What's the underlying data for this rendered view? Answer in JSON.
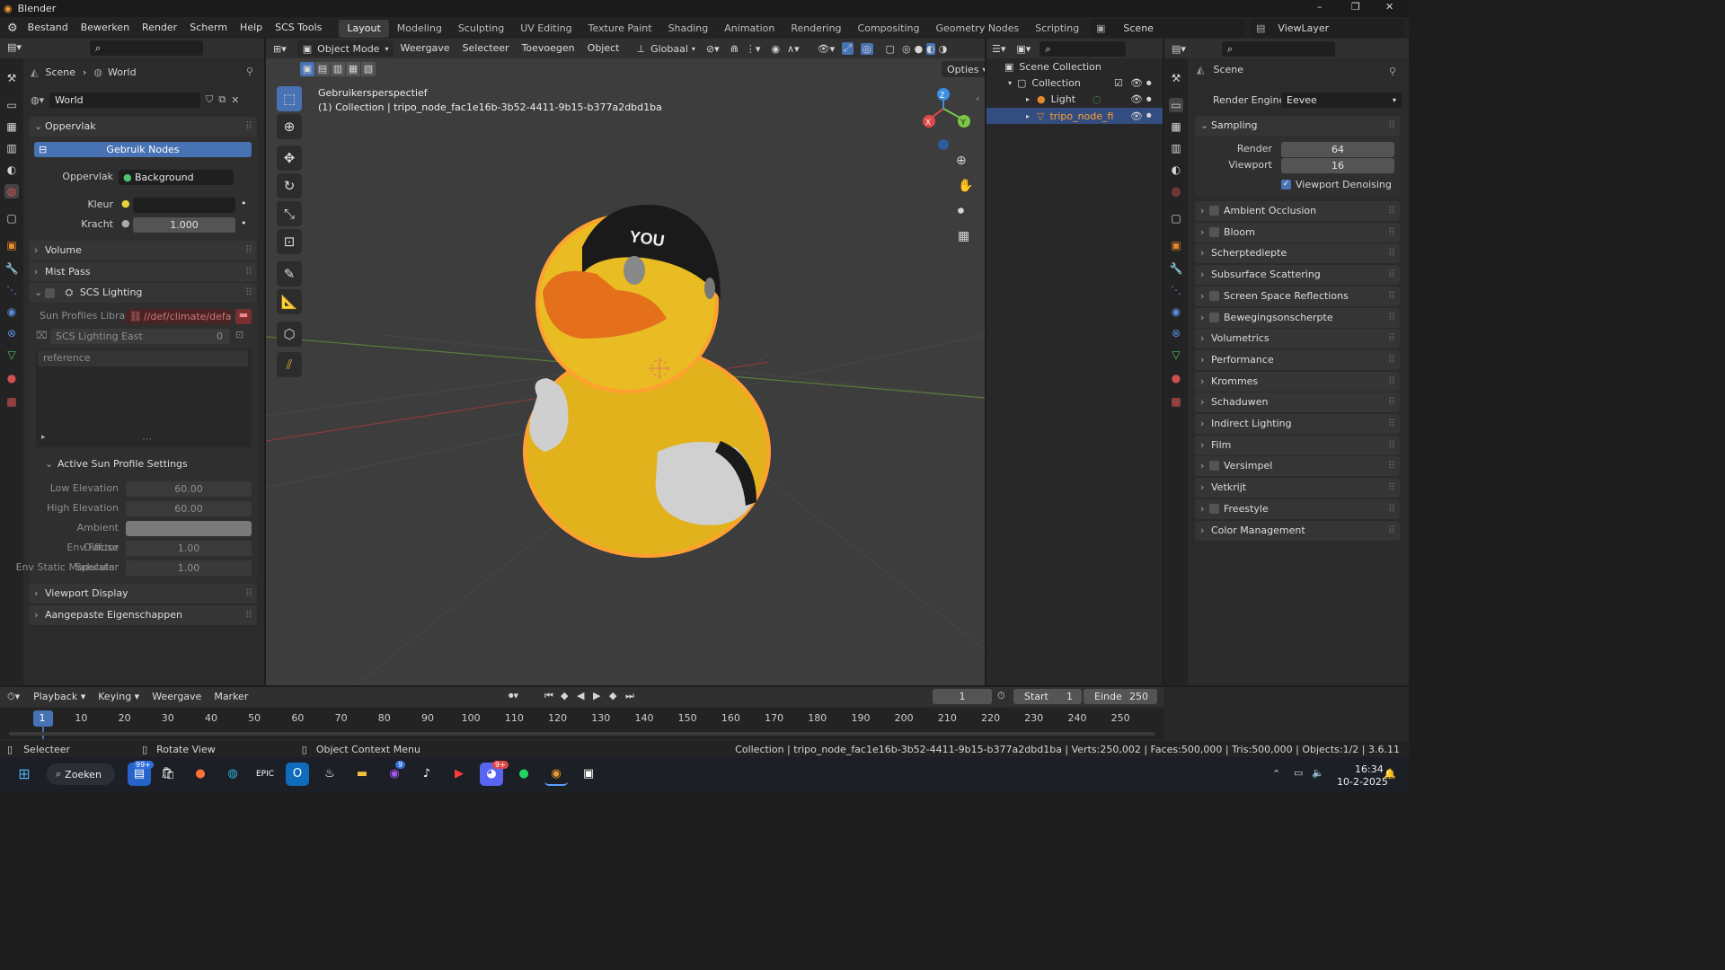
{
  "app": {
    "title": "Blender",
    "window_controls": [
      "–",
      "❐",
      "✕"
    ]
  },
  "menus": [
    "Bestand",
    "Bewerken",
    "Render",
    "Scherm",
    "Help",
    "SCS Tools"
  ],
  "workspace_tabs": [
    "Layout",
    "Modeling",
    "Sculpting",
    "UV Editing",
    "Texture Paint",
    "Shading",
    "Animation",
    "Rendering",
    "Compositing",
    "Geometry Nodes",
    "Scripting"
  ],
  "active_tab": "Layout",
  "scene_name": "Scene",
  "view_layer": "ViewLayer",
  "left_panel": {
    "breadcrumb": {
      "scene": "Scene",
      "world": "World"
    },
    "world_name": "World",
    "surface_header": "Oppervlak",
    "use_nodes_label": "Gebruik Nodes",
    "surface_label": "Oppervlak",
    "surface_value": "Background",
    "color_label": "Kleur",
    "strength_label": "Kracht",
    "strength_value": "1.000",
    "sections": {
      "volume": "Volume",
      "mist": "Mist Pass",
      "scs": "SCS Lighting",
      "viewport_display": "Viewport Display",
      "custom_props": "Aangepaste Eigenschappen"
    },
    "sun_profiles_label": "Sun Profiles Library",
    "sun_profiles_value": "//def/climate/defa...",
    "scs_east_label": "SCS Lighting East",
    "scs_east_value": "0",
    "list_item": "reference",
    "active_profile_header": "Active Sun Profile Settings",
    "profile_fields": [
      {
        "label": "Low Elevation",
        "value": "60.00"
      },
      {
        "label": "High Elevation",
        "value": "60.00"
      },
      {
        "label": "Ambient",
        "value": ""
      },
      {
        "label": "Diffuse",
        "value": ""
      },
      {
        "label": "Specular",
        "value": ""
      },
      {
        "label": "Env Factor",
        "value": "1.00"
      },
      {
        "label": "Env Static Modulator",
        "value": "1.00"
      }
    ]
  },
  "viewport": {
    "mode": "Object Mode",
    "menus": [
      "Weergave",
      "Selecteer",
      "Toevoegen",
      "Object"
    ],
    "orientation": "Globaal",
    "options_label": "Opties",
    "view_name": "Gebruikersperspectief",
    "collection_info": "(1) Collection | tripo_node_fac1e16b-3b52-4411-9b15-b377a2dbd1ba",
    "cap_text": "YOU",
    "gizmo_axes": {
      "x": "X",
      "y": "Y",
      "z": "Z"
    }
  },
  "outliner": {
    "root": "Scene Collection",
    "collection": "Collection",
    "items": [
      {
        "name": "Light"
      },
      {
        "name": "tripo_node_fi"
      }
    ]
  },
  "properties": {
    "header": "Scene",
    "render_engine_label": "Render Engine",
    "render_engine": "Eevee",
    "sampling_header": "Sampling",
    "render_label": "Render",
    "render_samples": "64",
    "viewport_label": "Viewport",
    "viewport_samples": "16",
    "denoise_label": "Viewport Denoising",
    "sections": [
      {
        "label": "Ambient Occlusion",
        "checkbox": true
      },
      {
        "label": "Bloom",
        "checkbox": true
      },
      {
        "label": "Scherptediepte",
        "checkbox": false
      },
      {
        "label": "Subsurface Scattering",
        "checkbox": false
      },
      {
        "label": "Screen Space Reflections",
        "checkbox": true
      },
      {
        "label": "Bewegingsonscherpte",
        "checkbox": true
      },
      {
        "label": "Volumetrics",
        "checkbox": false
      },
      {
        "label": "Performance",
        "checkbox": false
      },
      {
        "label": "Krommes",
        "checkbox": false
      },
      {
        "label": "Schaduwen",
        "checkbox": false
      },
      {
        "label": "Indirect Lighting",
        "checkbox": false
      },
      {
        "label": "Film",
        "checkbox": false
      },
      {
        "label": "Versimpel",
        "checkbox": true
      },
      {
        "label": "Vetkrijt",
        "checkbox": false
      },
      {
        "label": "Freestyle",
        "checkbox": true
      },
      {
        "label": "Color Management",
        "checkbox": false
      }
    ]
  },
  "timeline": {
    "menus": [
      "Playback",
      "Keying",
      "Weergave",
      "Marker"
    ],
    "current_frame": "1",
    "start_label": "Start",
    "start": "1",
    "end_label": "Einde",
    "end": "250",
    "ticks": [
      "1",
      "10",
      "20",
      "30",
      "40",
      "50",
      "60",
      "70",
      "80",
      "90",
      "100",
      "110",
      "120",
      "130",
      "140",
      "150",
      "160",
      "170",
      "180",
      "190",
      "200",
      "210",
      "220",
      "230",
      "240",
      "250"
    ]
  },
  "statusbar": {
    "select": "Selecteer",
    "rotate": "Rotate View",
    "context": "Object Context Menu",
    "info": "Collection | tripo_node_fac1e16b-3b52-4411-9b15-b377a2dbd1ba | Verts:250,002 | Faces:500,000 | Tris:500,000 | Objects:1/2 | 3.6.11"
  },
  "taskbar": {
    "search": "Zoeken",
    "badge_mail": "99+",
    "badge_messenger": "9",
    "badge_discord": "9+",
    "time": "16:34",
    "date": "10-2-2025"
  },
  "colors": {
    "accent": "#4772b3",
    "selection": "#ffa030",
    "duck": "#f2c21a"
  }
}
